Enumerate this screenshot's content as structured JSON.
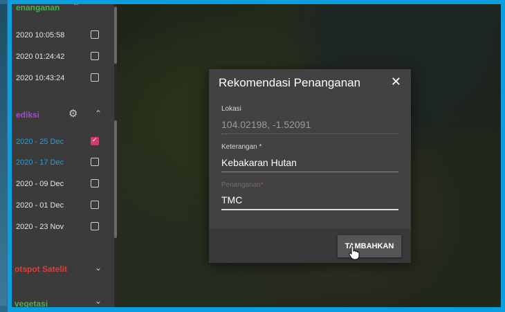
{
  "sidebar": {
    "section_penanganan": "enanganan",
    "penanganan_items": [
      {
        "label": "2020 10:05:58",
        "checked": false
      },
      {
        "label": "2020 01:24:42",
        "checked": false
      },
      {
        "label": "2020 10:43:24",
        "checked": false
      }
    ],
    "section_prediksi": "ediksi",
    "prediksi_items": [
      {
        "label": "2020 - 25 Dec",
        "checked": true
      },
      {
        "label": "2020 - 17 Dec",
        "checked": false
      },
      {
        "label": "2020 - 09 Dec",
        "checked": false
      },
      {
        "label": "2020 - 01 Dec",
        "checked": false
      },
      {
        "label": "2020 - 23 Nov",
        "checked": false
      }
    ],
    "section_hotspot": "otspot Satelit",
    "section_vegetasi": "vegetasi"
  },
  "dialog": {
    "title": "Rekomendasi Penanganan",
    "close_glyph": "✕",
    "lokasi_label": "Lokasi",
    "lokasi_value": "104.02198, -1.52091",
    "keterangan_label": "Keterangan",
    "required_mark": "*",
    "keterangan_value": "Kebakaran Hutan",
    "penanganan_label": "Penanganan",
    "penanganan_value": "TMC",
    "submit_label": "TAMBAHKAN"
  },
  "colors": {
    "accent_pink": "#d63a6a",
    "accent_cyan": "#2a9fd6",
    "accent_green": "#4caf50",
    "accent_purple": "#9c4fc7",
    "accent_red": "#e53935",
    "frame_blue": "#0aa0e0"
  }
}
